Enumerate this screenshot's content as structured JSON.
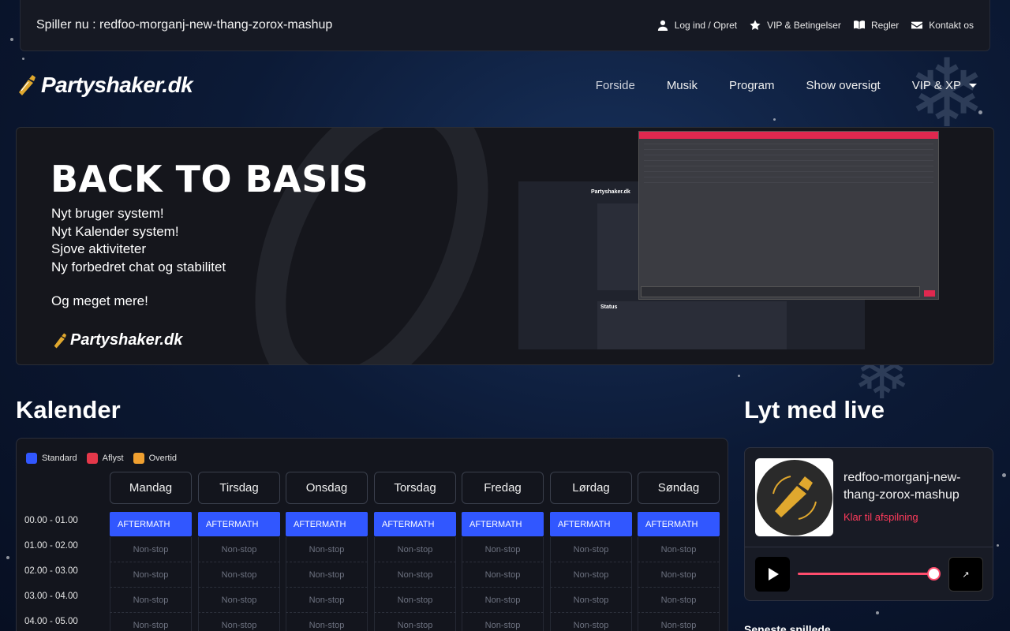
{
  "topbar": {
    "now_playing": "Spiller nu : redfoo-morganj-new-thang-zorox-mashup",
    "links": [
      {
        "label": "Log ind / Opret",
        "icon": "user-icon"
      },
      {
        "label": "VIP & Betingelser",
        "icon": "star-icon"
      },
      {
        "label": "Regler",
        "icon": "book-icon"
      },
      {
        "label": "Kontakt os",
        "icon": "envelope-icon"
      }
    ]
  },
  "header": {
    "logo_text": "Partyshaker.dk",
    "nav": [
      "Forside",
      "Musik",
      "Program",
      "Show oversigt",
      "VIP & XP"
    ]
  },
  "banner": {
    "title": "BACK TO BASIS",
    "lines": [
      "Nyt bruger system!",
      "Nyt Kalender system!",
      "Sjove aktiviteter",
      "Ny forbedret chat og stabilitet"
    ],
    "more": "Og meget mere!",
    "logo_text": "Partyshaker.dk",
    "screenshot_status_label": "Status",
    "screenshot_logo": "Partyshaker.dk"
  },
  "calendar": {
    "title": "Kalender",
    "legend": [
      {
        "label": "Standard",
        "color": "#3157ff"
      },
      {
        "label": "Aflyst",
        "color": "#e5384a"
      },
      {
        "label": "Overtid",
        "color": "#f0a030"
      }
    ],
    "days": [
      "Mandag",
      "Tirsdag",
      "Onsdag",
      "Torsdag",
      "Fredag",
      "Lørdag",
      "Søndag"
    ],
    "times": [
      "00.00 - 01.00",
      "01.00 - 02.00",
      "02.00 - 03.00",
      "03.00 - 04.00",
      "04.00 - 05.00"
    ],
    "event_label": "AFTERMATH",
    "empty_label": "Non-stop"
  },
  "player": {
    "title": "Lyt med live",
    "track": "redfoo-morganj-new-thang-zorox-mashup",
    "status": "Klar til afspilning",
    "volume": 1.0,
    "popout_icon": "↗",
    "recent_title": "Seneste spillede"
  }
}
